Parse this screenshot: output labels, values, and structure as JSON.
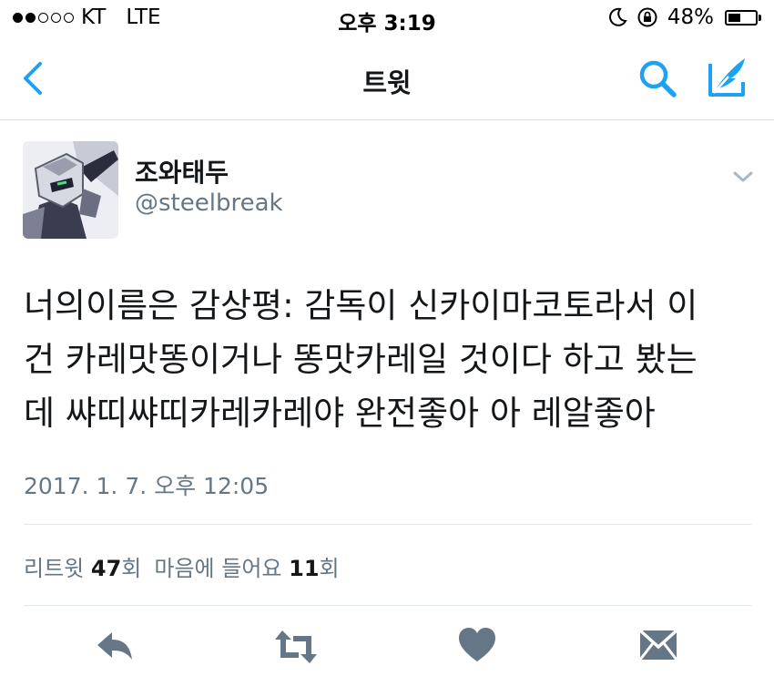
{
  "status_bar": {
    "carrier": "KT",
    "network": "LTE",
    "time": "오후 3:19",
    "battery": "48%",
    "battery_level": 0.48
  },
  "nav": {
    "title": "트윗",
    "back_icon": "chevron-left-icon",
    "search_icon": "search-icon",
    "compose_icon": "compose-icon"
  },
  "tweet": {
    "display_name": "조와태두",
    "username": "@steelbreak",
    "text_lines": [
      "너의이름은 감상평: 감독이 신카이마코토라서 이",
      "건 카레맛똥이거나 똥맛카레일 것이다 하고 봤는",
      "데 쌰띠쌰띠카레카레야 완전좋아 아 레알좋아"
    ],
    "timestamp": "2017. 1. 7. 오후 12:05",
    "retweet_label": "리트윗",
    "retweet_count": "47",
    "retweet_suffix": "회",
    "like_label": "마음에 들어요",
    "like_count": "11",
    "like_suffix": "회"
  },
  "colors": {
    "accent": "#1da1f2",
    "icon_gray": "#657786",
    "divider": "#e1e8ed"
  }
}
